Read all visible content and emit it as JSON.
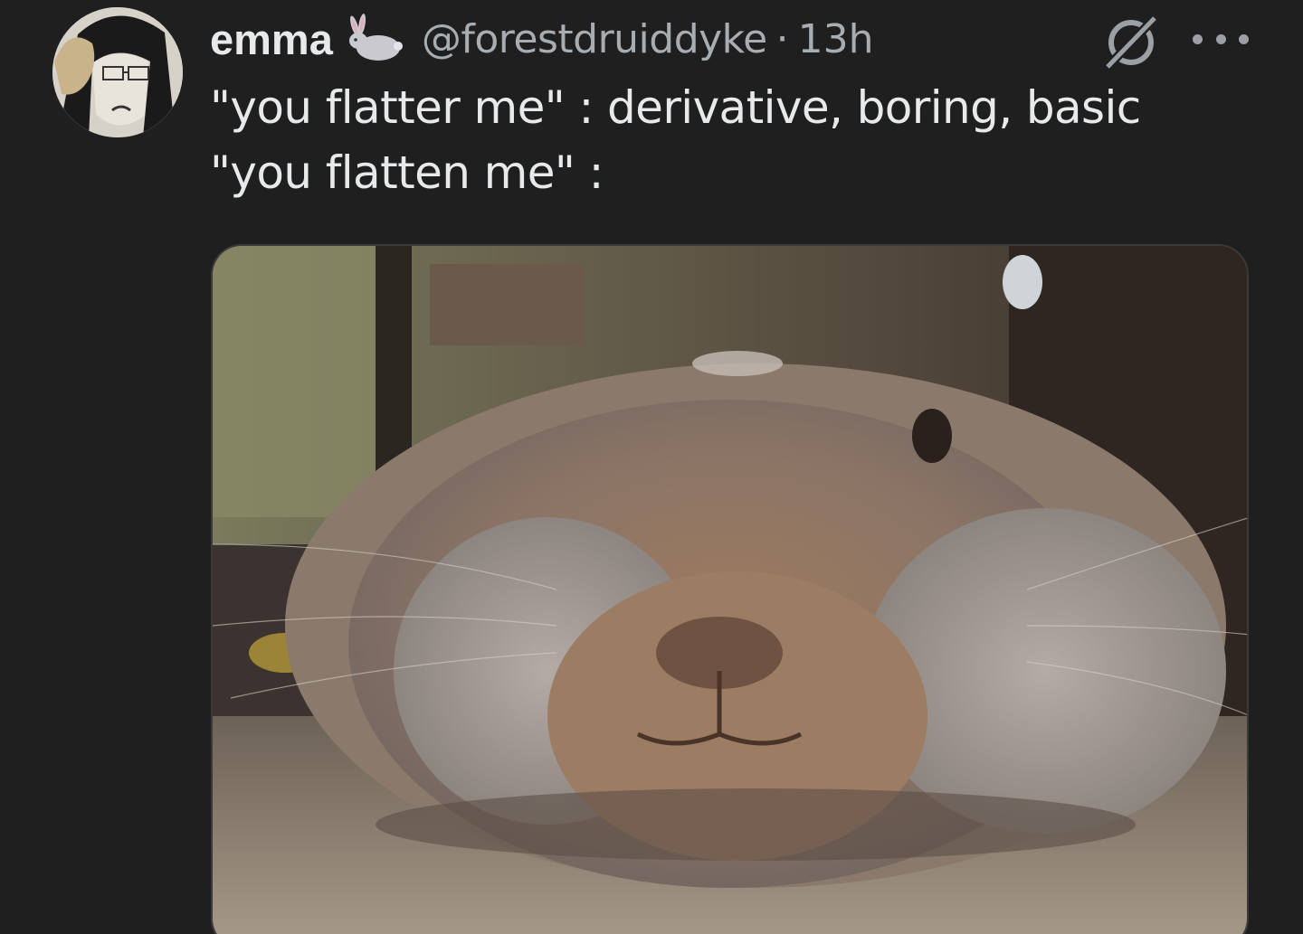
{
  "tweet": {
    "display_name": "emma",
    "handle": "@forestdruiddyke",
    "separator": "·",
    "time": "13h",
    "text_line_1": "\"you flatter me\" : derivative, boring, basic",
    "text_line_2": "\"you flatten me\" :"
  },
  "icons": {
    "name_emoji": "rabbit-icon",
    "grok": "grok-icon",
    "more": "more-icon"
  },
  "colors": {
    "background": "#1f1f1f",
    "primary_text": "#e7e9ea",
    "secondary_text": "#a8adb2"
  }
}
